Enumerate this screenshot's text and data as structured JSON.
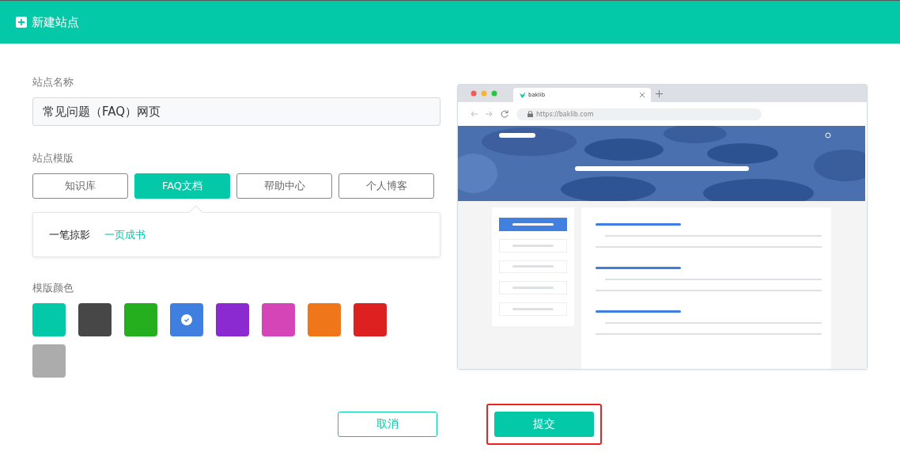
{
  "dialog": {
    "title": "新建站点"
  },
  "site_name": {
    "label": "站点名称",
    "value": "常见问题（FAQ）网页"
  },
  "template": {
    "label": "站点模版",
    "options": [
      {
        "label": "知识库",
        "selected": false
      },
      {
        "label": "FAQ文档",
        "selected": true
      },
      {
        "label": "帮助中心",
        "selected": false
      },
      {
        "label": "个人博客",
        "selected": false
      }
    ],
    "styles": [
      {
        "label": "一笔掠影",
        "selected": false
      },
      {
        "label": "一页成书",
        "selected": true
      }
    ]
  },
  "colors": {
    "label": "模版颜色",
    "swatches": [
      {
        "color": "#03c9a9",
        "selected": false
      },
      {
        "color": "#474747",
        "selected": false
      },
      {
        "color": "#25ae1d",
        "selected": false
      },
      {
        "color": "#3f7fe0",
        "selected": true
      },
      {
        "color": "#8a2ad0",
        "selected": false
      },
      {
        "color": "#d545b8",
        "selected": false
      },
      {
        "color": "#f0761a",
        "selected": false
      },
      {
        "color": "#dd2121",
        "selected": false
      },
      {
        "color": "#acacac",
        "selected": false
      }
    ]
  },
  "preview": {
    "tab_title": "baklib",
    "url": "https://baklib.com"
  },
  "buttons": [
    {
      "label": "取消",
      "kind": "secondary",
      "highlighted": false
    },
    {
      "label": "提交",
      "kind": "primary",
      "highlighted": true
    }
  ]
}
